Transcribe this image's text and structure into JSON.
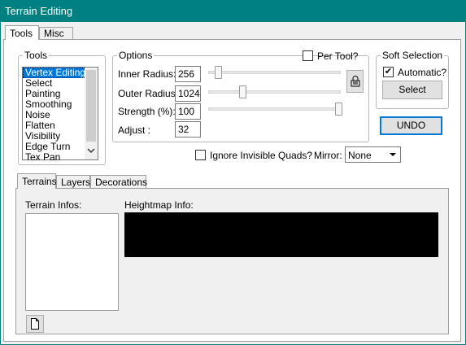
{
  "window": {
    "title": "Terrain Editing"
  },
  "main_tabs": [
    "Tools",
    "Misc"
  ],
  "tools": {
    "legend": "Tools",
    "items": [
      "Vertex Editing",
      "Select",
      "Painting",
      "Smoothing",
      "Noise",
      "Flatten",
      "Visibility",
      "Edge Turn",
      "Tex Pan"
    ],
    "selected": "Vertex Editing"
  },
  "options": {
    "legend": "Options",
    "per_tool_label": "Per Tool?",
    "per_tool_checked": false,
    "inner_radius_label": "Inner Radius:",
    "inner_radius_value": "256",
    "outer_radius_label": "Outer Radius:",
    "outer_radius_value": "1024",
    "strength_label": "Strength (%):",
    "strength_value": "100",
    "adjust_label": "Adjust :",
    "adjust_value": "32",
    "lock_icon": "lock-icon"
  },
  "soft_selection": {
    "legend": "Soft Selection",
    "automatic_label": "Automatic?",
    "automatic_checked": true,
    "select_button": "Select"
  },
  "undo_button": "UNDO",
  "ignore_invisible_label": "Ignore Invisible Quads?",
  "mirror_label": "Mirror:",
  "mirror_value": "None",
  "lower_tabs": [
    "Terrains",
    "Layers",
    "Decorations"
  ],
  "terrain_infos_label": "Terrain Infos:",
  "heightmap_info_label": "Heightmap Info:",
  "new_doc_icon": "new-document-icon"
}
